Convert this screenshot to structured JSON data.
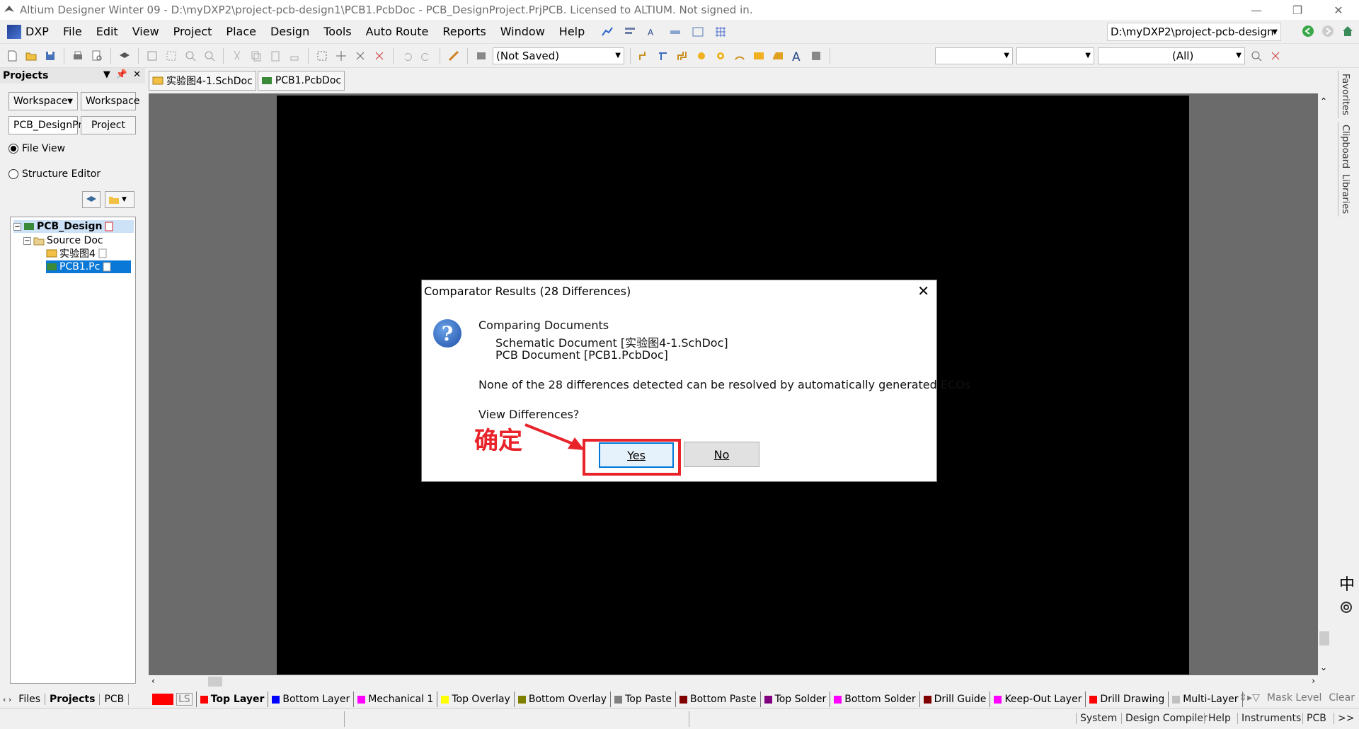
{
  "window": {
    "title": "Altium Designer Winter 09 - D:\\myDXP2\\project-pcb-design1\\PCB1.PcbDoc - PCB_DesignProject.PrjPCB. Licensed to ALTIUM. Not signed in."
  },
  "menu": {
    "items": [
      "DXP",
      "File",
      "Edit",
      "View",
      "Project",
      "Place",
      "Design",
      "Tools",
      "Auto Route",
      "Reports",
      "Window",
      "Help"
    ],
    "path": "D:\\myDXP2\\project-pcb-design"
  },
  "toolbar": {
    "saved_combo": "(Not Saved)",
    "filter_combo": "(All)"
  },
  "projects_panel": {
    "header": "Projects",
    "workspace_dropdown": "Workspace",
    "workspace_button": "Workspace",
    "project_field": "PCB_DesignPr",
    "project_button": "Project",
    "file_view": "File View",
    "structure_editor": "Structure Editor",
    "tree": {
      "project": "PCB_Design",
      "folder": "Source Doc",
      "doc1": "实验图4",
      "doc2": "PCB1.Pc"
    }
  },
  "doc_tabs": [
    "实验图4-1.SchDoc",
    "PCB1.PcbDoc"
  ],
  "right_sidebar": [
    "Favorites",
    "Clipboard",
    "Libraries"
  ],
  "bottom_panel_tabs": [
    "Files",
    "Projects",
    "PCB"
  ],
  "layers": [
    {
      "label": "LS",
      "color": "#ff0000"
    },
    {
      "label": "Top Layer",
      "color": "#ff0000"
    },
    {
      "label": "Bottom Layer",
      "color": "#0000ff"
    },
    {
      "label": "Mechanical 1",
      "color": "#ff00ff"
    },
    {
      "label": "Top Overlay",
      "color": "#ffff00"
    },
    {
      "label": "Bottom Overlay",
      "color": "#808000"
    },
    {
      "label": "Top Paste",
      "color": "#808080"
    },
    {
      "label": "Bottom Paste",
      "color": "#800000"
    },
    {
      "label": "Top Solder",
      "color": "#800080"
    },
    {
      "label": "Bottom Solder",
      "color": "#ff00ff"
    },
    {
      "label": "Drill Guide",
      "color": "#800000"
    },
    {
      "label": "Keep-Out Layer",
      "color": "#ff00ff"
    },
    {
      "label": "Drill Drawing",
      "color": "#ff0000"
    },
    {
      "label": "Multi-Layer",
      "color": "#c0c0c0"
    }
  ],
  "layer_actions": {
    "mask_level": "Mask Level",
    "clear": "Clear"
  },
  "status_bar": [
    "System",
    "Design Compiler",
    "Help",
    "Instruments",
    "PCB",
    ">>"
  ],
  "ime": {
    "lang": "中"
  },
  "dialog": {
    "title": "Comparator Results (28 Differences)",
    "line1": "Comparing Documents",
    "line2": "Schematic Document [实验图4-1.SchDoc]",
    "line3": "PCB Document [PCB1.PcbDoc]",
    "message": "None of the 28 differences detected can be resolved by automatically generated ECOs",
    "question": "View Differences?",
    "yes_label": "Yes",
    "no_label": "No"
  },
  "annotation": {
    "text": "确定",
    "color": "#e8232a"
  }
}
